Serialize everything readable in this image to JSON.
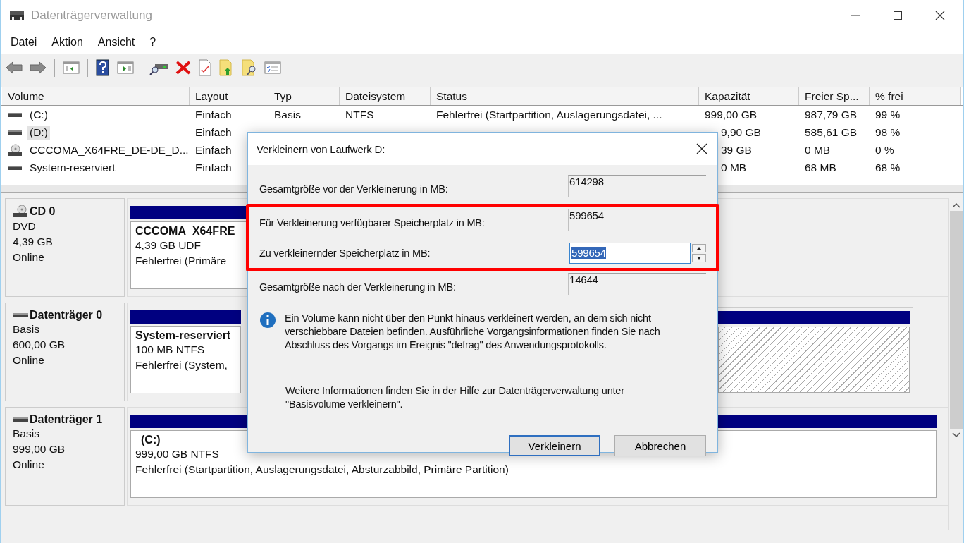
{
  "window": {
    "title": "Datenträgerverwaltung",
    "active": false
  },
  "menu": [
    "Datei",
    "Aktion",
    "Ansicht",
    "?"
  ],
  "table": {
    "columns": [
      "Volume",
      "Layout",
      "Typ",
      "Dateisystem",
      "Status",
      "Kapazität",
      "Freier Sp...",
      "% frei"
    ],
    "rows": [
      {
        "kind": "disk",
        "selected": false,
        "cells": [
          "(C:)",
          "Einfach",
          "Basis",
          "NTFS",
          "Fehlerfrei (Startpartition, Auslagerungsdatei, ...",
          "999,00 GB",
          "987,79 GB",
          "99 %"
        ]
      },
      {
        "kind": "disk",
        "selected": true,
        "cells": [
          "(D:)",
          "Einfach",
          null,
          null,
          null,
          "9,90 GB",
          "585,61 GB",
          "98 %"
        ]
      },
      {
        "kind": "cd",
        "selected": false,
        "cells": [
          "CCCOMA_X64FRE_DE-DE_D...",
          "Einfach",
          null,
          null,
          null,
          "39 GB",
          "0 MB",
          "0 %"
        ]
      },
      {
        "kind": "disk",
        "selected": false,
        "cells": [
          "System-reserviert",
          "Einfach",
          null,
          null,
          null,
          "0 MB",
          "68 MB",
          "68 %"
        ]
      }
    ]
  },
  "disks": [
    {
      "kind": "cd",
      "name": "CD 0",
      "lines": [
        "DVD",
        "4,39 GB",
        "Online"
      ],
      "partitions": [
        {
          "kind": "primary",
          "title": "CCCOMA_X64FRE_",
          "lines": [
            "4,39 GB UDF",
            "Fehlerfrei (Primäre"
          ]
        }
      ]
    },
    {
      "kind": "disk",
      "name": "Datenträger 0",
      "lines": [
        "Basis",
        "600,00 GB",
        "Online"
      ],
      "partitions": [
        {
          "kind": "primary",
          "title": "System-reserviert",
          "lines": [
            "100 MB NTFS",
            "Fehlerfrei (System,"
          ]
        },
        {
          "kind": "unallocated"
        }
      ]
    },
    {
      "kind": "disk",
      "name": "Datenträger 1",
      "lines": [
        "Basis",
        "999,00 GB",
        "Online"
      ],
      "partitions": [
        {
          "kind": "primary",
          "title": "(C:)",
          "lines": [
            "999,00 GB NTFS",
            "Fehlerfrei (Startpartition, Auslagerungsdatei, Absturzabbild, Primäre Partition)"
          ]
        }
      ]
    }
  ],
  "dialog": {
    "title": "Verkleinern von Laufwerk D:",
    "groups": [
      {
        "highlighted": false,
        "fields": [
          {
            "kind": "readonly",
            "label": "Gesamtgröße vor der Verkleinerung in MB:",
            "value": "614298"
          }
        ]
      },
      {
        "highlighted": true,
        "fields": [
          {
            "kind": "readonly",
            "label": "Für Verkleinerung verfügbarer Speicherplatz in MB:",
            "value": "599654"
          },
          {
            "kind": "spin",
            "label": "Zu verkleinernder Speicherplatz in MB:",
            "value": "599654",
            "text_selected": true
          }
        ]
      },
      {
        "highlighted": false,
        "fields": [
          {
            "kind": "readonly",
            "label": "Gesamtgröße nach der Verkleinerung in MB:",
            "value": "14644"
          }
        ]
      }
    ],
    "info": "Ein Volume kann nicht über den Punkt hinaus verkleinert werden, an dem sich nicht verschiebbare Dateien befinden. Ausführliche Vorgangsinformationen finden Sie nach Abschluss des Vorgangs im Ereignis \"defrag\" des Anwendungsprotokolls.",
    "more": "Weitere Informationen finden Sie in der Hilfe zur Datenträgerverwaltung unter \"Basisvolume verkleinern\".",
    "buttons": [
      {
        "label": "Verkleinern",
        "default": true
      },
      {
        "label": "Abbrechen",
        "default": false
      }
    ]
  }
}
